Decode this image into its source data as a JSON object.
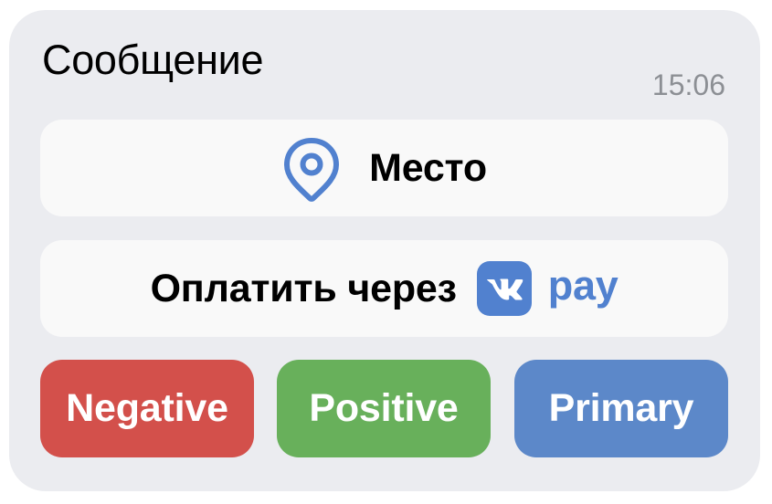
{
  "message": {
    "text": "Сообщение",
    "time": "15:06"
  },
  "buttons": {
    "location": {
      "label": "Место",
      "icon": "map-pin-icon",
      "icon_color": "#5181cf"
    },
    "pay": {
      "label": "Оплатить через",
      "logo": "vk-logo-icon",
      "brand_word": "pay",
      "brand_color": "#5181cf"
    },
    "negative": {
      "label": "Negative",
      "color": "#d3504b"
    },
    "positive": {
      "label": "Positive",
      "color": "#68b05b"
    },
    "primary": {
      "label": "Primary",
      "color": "#5c88c9"
    }
  },
  "colors": {
    "bubble_background": "#ebecf0",
    "light_button_background": "#f9f9f9",
    "time_text": "#8c8f94"
  }
}
